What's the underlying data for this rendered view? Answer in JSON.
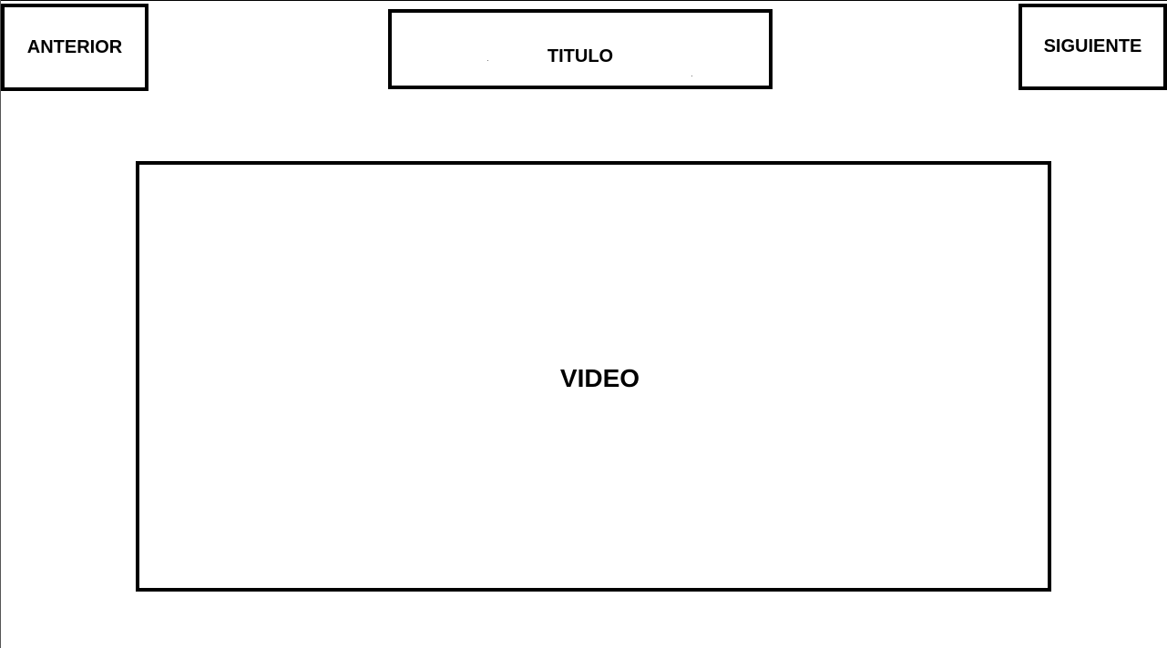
{
  "nav": {
    "prev_label": "ANTERIOR",
    "next_label": "SIGUIENTE"
  },
  "header": {
    "title": "TITULO"
  },
  "main": {
    "video_label": "VIDEO"
  }
}
